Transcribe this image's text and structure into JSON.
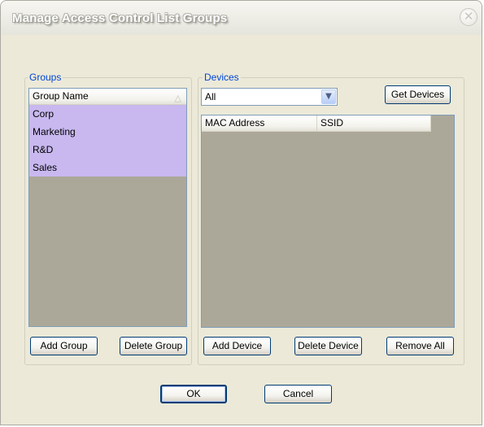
{
  "window": {
    "title": "Manage Access Control List Groups",
    "close_glyph": "✕"
  },
  "groups": {
    "label": "Groups",
    "column_header": "Group Name",
    "sort_icon": "△",
    "items": [
      "Corp",
      "Marketing",
      "R&D",
      "Sales"
    ],
    "selected_color": "#c8b8ef",
    "add_button": "Add Group",
    "delete_button": "Delete Group"
  },
  "devices": {
    "label": "Devices",
    "filter_value": "All",
    "dropdown_glyph": "▼",
    "get_devices_button": "Get Devices",
    "columns": [
      "MAC Address",
      "SSID"
    ],
    "add_button": "Add Device",
    "delete_button": "Delete Device",
    "remove_all_button": "Remove All"
  },
  "footer": {
    "ok_button": "OK",
    "cancel_button": "Cancel"
  },
  "colors": {
    "group_label": "#0046d5",
    "dialog_bg": "#ece9d8",
    "list_bg": "#aca899",
    "button_border": "#003c74"
  }
}
